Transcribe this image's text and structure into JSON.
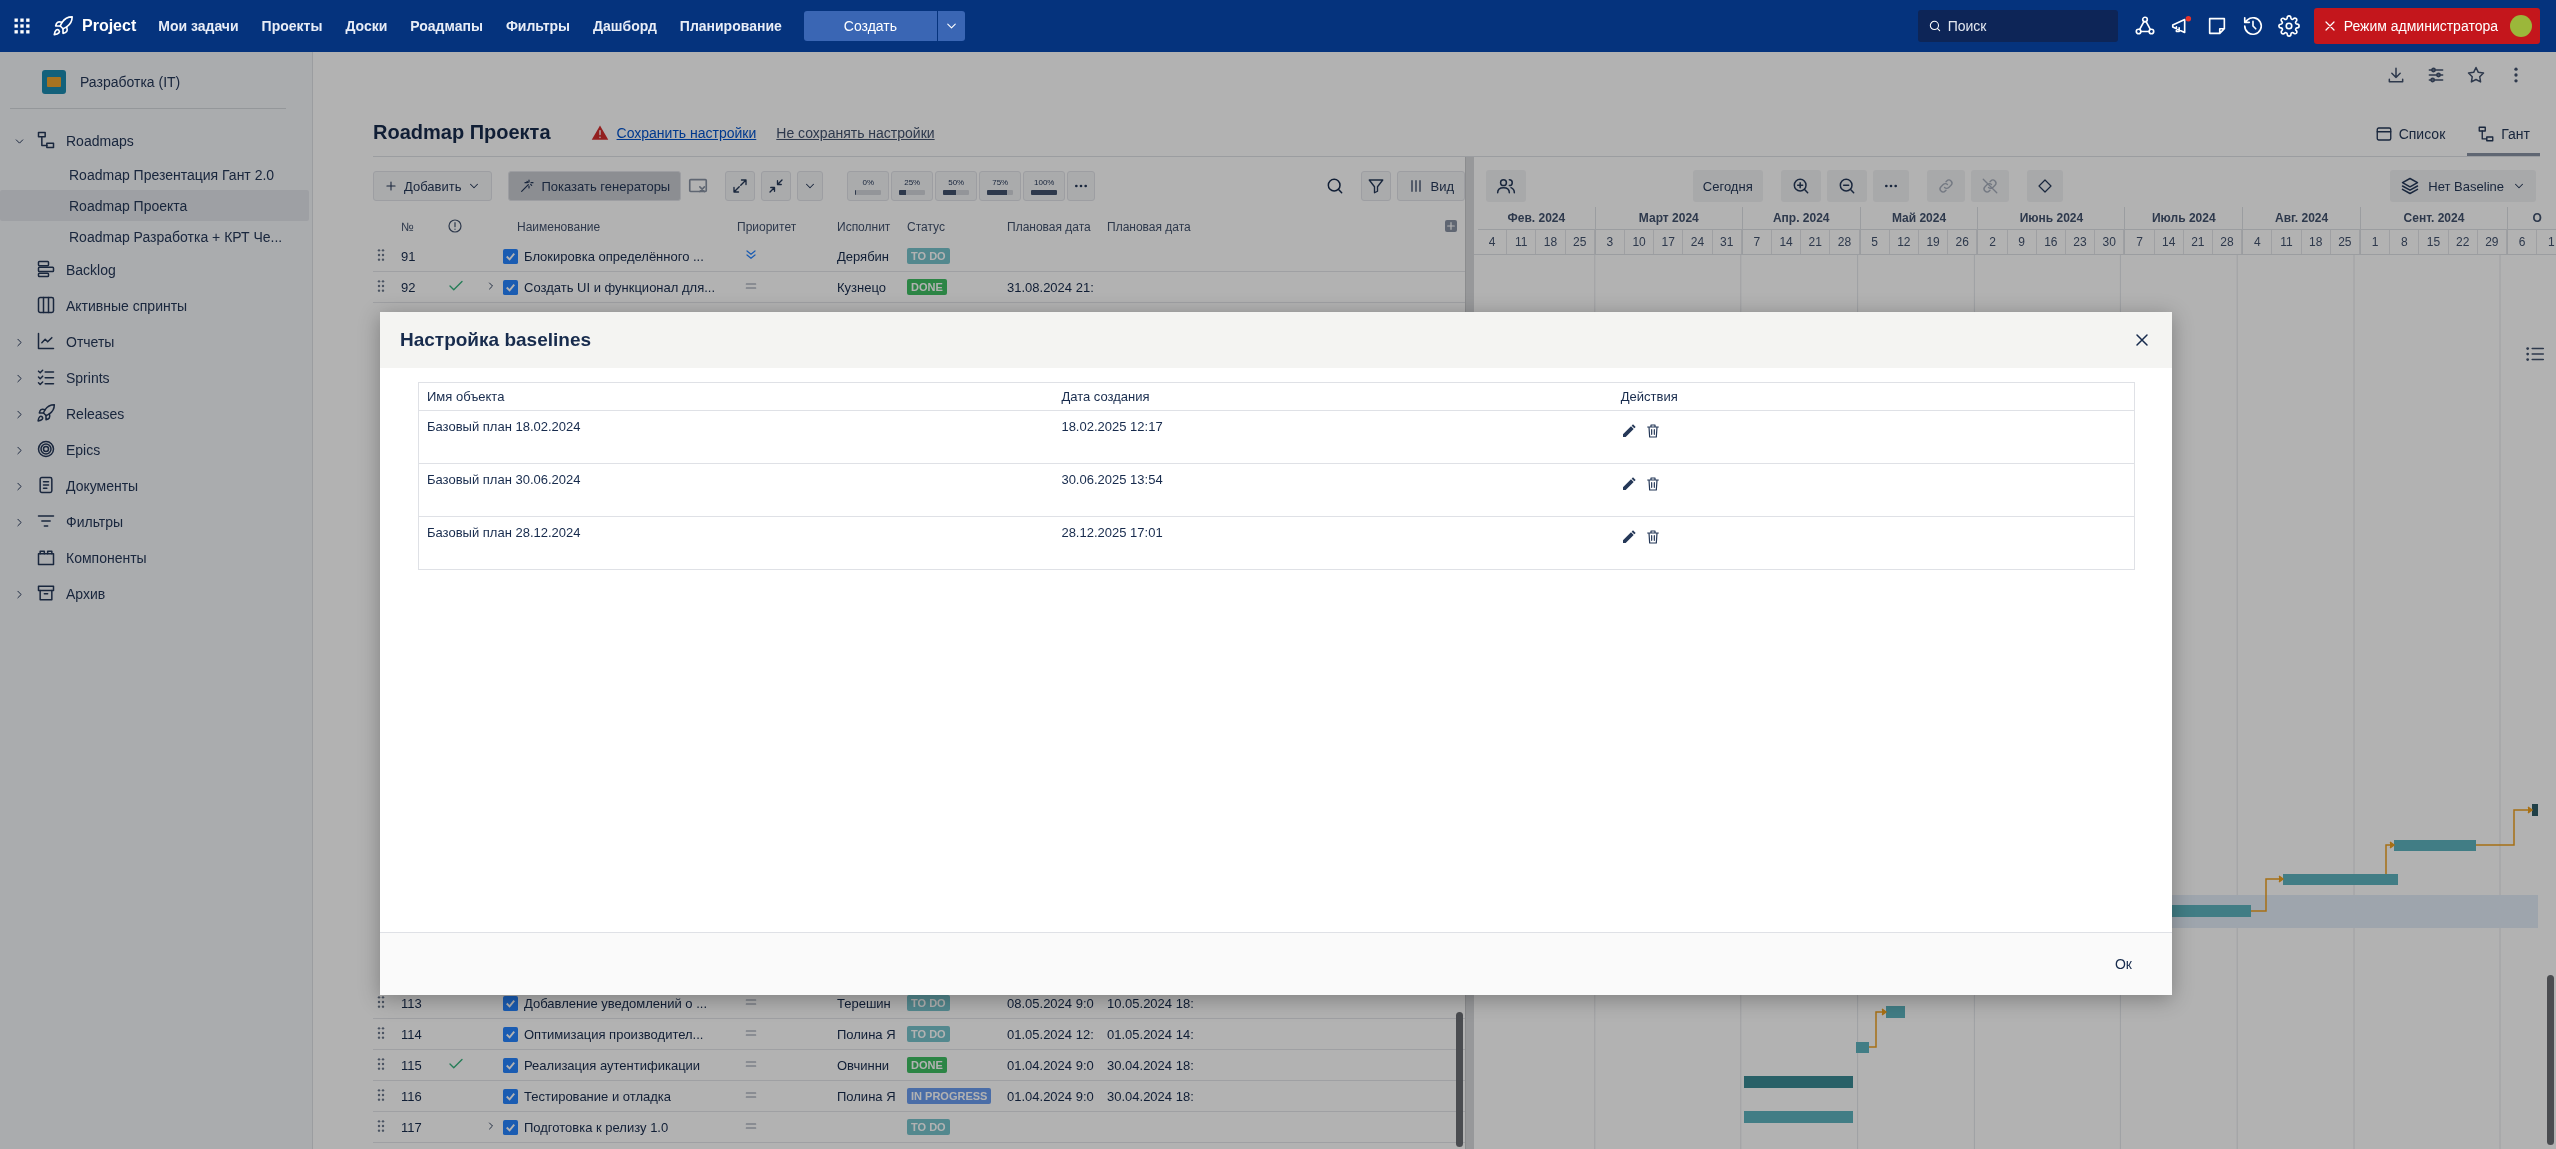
{
  "topbar": {
    "app_name": "Project",
    "nav": [
      "Мои задачи",
      "Проекты",
      "Доски",
      "Роадмапы",
      "Фильтры",
      "Дашборд",
      "Планирование"
    ],
    "create_button": "Создать",
    "search": {
      "placeholder": "Поиск"
    },
    "admin_button": "Режим администратора"
  },
  "sidebar": {
    "project": "Разработка (IT)",
    "items": [
      {
        "label": "Roadmaps",
        "kind": "group",
        "expanded": true,
        "selected": false,
        "children": [
          {
            "label": "Roadmap Презентация Гант 2.0",
            "selected": false
          },
          {
            "label": "Roadmap Проекта",
            "selected": true
          },
          {
            "label": "Roadmap Разработка + КРТ Че...",
            "selected": false
          }
        ]
      },
      {
        "label": "Backlog",
        "kind": "link",
        "selected": false
      },
      {
        "label": "Активные спринты",
        "kind": "link",
        "selected": false
      },
      {
        "label": "Отчеты",
        "kind": "group",
        "expanded": false,
        "selected": false
      },
      {
        "label": "Sprints",
        "kind": "group",
        "expanded": false,
        "selected": false
      },
      {
        "label": "Releases",
        "kind": "group",
        "expanded": false,
        "selected": false
      },
      {
        "label": "Epics",
        "kind": "group",
        "expanded": false,
        "selected": false
      },
      {
        "label": "Документы",
        "kind": "group",
        "expanded": false,
        "selected": false
      },
      {
        "label": "Фильтры",
        "kind": "group",
        "expanded": false,
        "selected": false
      },
      {
        "label": "Компоненты",
        "kind": "link",
        "selected": false
      },
      {
        "label": "Архив",
        "kind": "group",
        "expanded": false,
        "selected": false
      }
    ]
  },
  "header": {
    "title": "Roadmap Проекта",
    "save_link": "Сохранить настройки",
    "discard_link": "Не сохранять настройки",
    "view_tabs": [
      {
        "label": "Список",
        "selected": false
      },
      {
        "label": "Гант",
        "selected": true
      }
    ]
  },
  "toolbar": {
    "add_button": "Добавить",
    "generators_button": {
      "label": "Показать генераторы",
      "active": true
    },
    "progress_buttons": [
      {
        "label": "0%",
        "level": 0
      },
      {
        "label": "25%",
        "level": 0.25
      },
      {
        "label": "50%",
        "level": 0.5
      },
      {
        "label": "75%",
        "level": 0.75
      },
      {
        "label": "100%",
        "level": 1
      }
    ],
    "view_button": "Вид"
  },
  "table": {
    "columns": [
      "№",
      "Наименование",
      "Приоритет",
      "Исполнит",
      "Статус",
      "Плановая дата",
      "Плановая дата"
    ],
    "rows": [
      {
        "number": "91",
        "done": false,
        "expandable": false,
        "checked": true,
        "title": "Блокировка определённого ...",
        "priority": {
          "kind": "lowest"
        },
        "assignee": "Дерябин",
        "status": {
          "label": "TO DO",
          "kind": "todo"
        }
      },
      {
        "number": "92",
        "done": true,
        "expandable": true,
        "checked": true,
        "title": "Создать UI и функционал для...",
        "priority": {
          "kind": "medium"
        },
        "assignee": "Кузнецо",
        "status": {
          "label": "DONE",
          "kind": "done"
        },
        "start": "31.08.2024 21:"
      },
      {
        "number": "113",
        "done": false,
        "expandable": false,
        "checked": true,
        "title": "Добавление уведомлений о ...",
        "priority": {
          "kind": "medium"
        },
        "assignee": "Терешин",
        "status": {
          "label": "TO DO",
          "kind": "todo"
        },
        "start": "08.05.2024 9:0",
        "end": "10.05.2024 18:"
      },
      {
        "number": "114",
        "done": false,
        "expandable": false,
        "checked": true,
        "title": "Оптимизация производител...",
        "priority": {
          "kind": "medium"
        },
        "assignee": "Полина Я",
        "status": {
          "label": "TO DO",
          "kind": "todo"
        },
        "start": "01.05.2024 12:",
        "end": "01.05.2024 14:"
      },
      {
        "number": "115",
        "done": true,
        "expandable": false,
        "checked": true,
        "title": "Реализация аутентификации",
        "priority": {
          "kind": "medium"
        },
        "assignee": "Овчинни",
        "status": {
          "label": "DONE",
          "kind": "done"
        },
        "start": "01.04.2024 9:0",
        "end": "30.04.2024 18:"
      },
      {
        "number": "116",
        "done": false,
        "expandable": false,
        "checked": true,
        "title": "Тестирование и отладка",
        "priority": {
          "kind": "medium"
        },
        "assignee": "Полина Я",
        "status": {
          "label": "IN PROGRESS",
          "kind": "in_progress"
        },
        "start": "01.04.2024 9:0",
        "end": "30.04.2024 18:"
      },
      {
        "number": "117",
        "done": false,
        "expandable": true,
        "checked": true,
        "title": "Подготовка к релизу 1.0",
        "priority": {
          "kind": "medium"
        },
        "status": {
          "label": "TO DO",
          "kind": "todo"
        }
      }
    ]
  },
  "gantt": {
    "today_button": "Сегодня",
    "baseline_button": "Нет Baseline",
    "months": [
      {
        "label": "Фев. 2024",
        "weeks": [
          "4",
          "11",
          "18",
          "25"
        ]
      },
      {
        "label": "Март 2024",
        "weeks": [
          "3",
          "10",
          "17",
          "24",
          "31"
        ]
      },
      {
        "label": "Апр. 2024",
        "weeks": [
          "7",
          "14",
          "21",
          "28"
        ]
      },
      {
        "label": "Май 2024",
        "weeks": [
          "5",
          "12",
          "19",
          "26"
        ]
      },
      {
        "label": "Июнь 2024",
        "weeks": [
          "2",
          "9",
          "16",
          "23",
          "30"
        ]
      },
      {
        "label": "Июль 2024",
        "weeks": [
          "7",
          "14",
          "21",
          "28"
        ]
      },
      {
        "label": "Авг. 2024",
        "weeks": [
          "4",
          "11",
          "18",
          "25"
        ]
      },
      {
        "label": "Сент. 2024",
        "weeks": [
          "1",
          "8",
          "15",
          "22",
          "29"
        ]
      },
      {
        "label": "О",
        "weeks": [
          "6",
          "1"
        ]
      }
    ]
  },
  "dialog": {
    "title": "Настройка baselines",
    "columns": [
      "Имя объекта",
      "Дата создания",
      "Действия"
    ],
    "rows": [
      {
        "name": "Базовый план 18.02.2024",
        "created": "18.02.2025 12:17"
      },
      {
        "name": "Базовый план 30.06.2024",
        "created": "30.06.2025 13:54"
      },
      {
        "name": "Базовый план 28.12.2024",
        "created": "28.12.2025 17:01"
      }
    ],
    "ok_button": "Ок"
  }
}
